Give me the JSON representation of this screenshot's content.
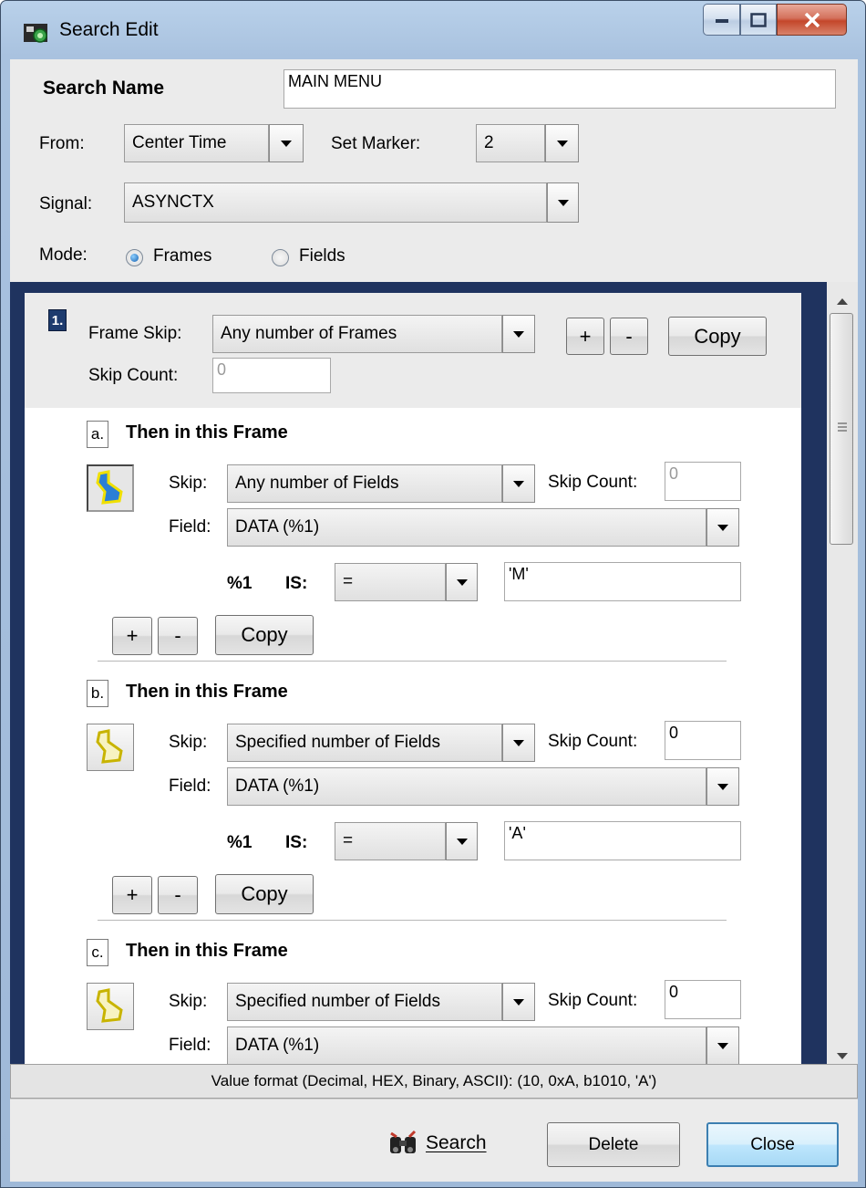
{
  "window": {
    "title": "Search Edit",
    "controls": {
      "minimize": "minimize",
      "maximize": "maximize",
      "close": "close"
    }
  },
  "header": {
    "search_name_label": "Search Name",
    "search_name_value": "MAIN MENU",
    "from_label": "From:",
    "from_value": "Center Time",
    "set_marker_label": "Set Marker:",
    "set_marker_value": "2",
    "signal_label": "Signal:",
    "signal_value": "ASYNCTX",
    "mode_label": "Mode:",
    "mode_options": [
      {
        "label": "Frames",
        "selected": true
      },
      {
        "label": "Fields",
        "selected": false
      }
    ]
  },
  "frame_step": {
    "index": "1.",
    "frame_skip_label": "Frame Skip:",
    "frame_skip_value": "Any number of Frames",
    "skip_count_label": "Skip Count:",
    "skip_count_value": "0",
    "plus_label": "+",
    "minus_label": "-",
    "copy_label": "Copy"
  },
  "sub_steps": [
    {
      "index": "a.",
      "title": "Then in this Frame",
      "skip_label": "Skip:",
      "skip_value": "Any number of Fields",
      "skip_count_label": "Skip Count:",
      "skip_count_value": "0",
      "field_label": "Field:",
      "field_value": "DATA   (%1)",
      "var_label": "%1",
      "is_label": "IS:",
      "operator": "=",
      "match_value": "'M'",
      "plus_label": "+",
      "minus_label": "-",
      "copy_label": "Copy",
      "icon": "field-link-icon"
    },
    {
      "index": "b.",
      "title": "Then in this Frame",
      "skip_label": "Skip:",
      "skip_value": "Specified number of Fields",
      "skip_count_label": "Skip Count:",
      "skip_count_value": "0",
      "field_label": "Field:",
      "field_value": "DATA   (%1)",
      "var_label": "%1",
      "is_label": "IS:",
      "operator": "=",
      "match_value": "'A'",
      "plus_label": "+",
      "minus_label": "-",
      "copy_label": "Copy",
      "icon": "field-link-icon"
    },
    {
      "index": "c.",
      "title": "Then in this Frame",
      "skip_label": "Skip:",
      "skip_value": "Specified number of Fields",
      "skip_count_label": "Skip Count:",
      "skip_count_value": "0",
      "field_label": "Field:",
      "field_value": "DATA   (%1)",
      "icon": "field-link-icon"
    }
  ],
  "status_text": "Value format (Decimal, HEX, Binary, ASCII):  (10, 0xA, b1010, 'A')",
  "footer": {
    "search_label": "Search",
    "delete_label": "Delete",
    "close_label": "Close"
  },
  "colors": {
    "panel_border": "#1f335f",
    "close_button_border": "#3c7fb1",
    "item_badge": "#1d3b6e"
  }
}
